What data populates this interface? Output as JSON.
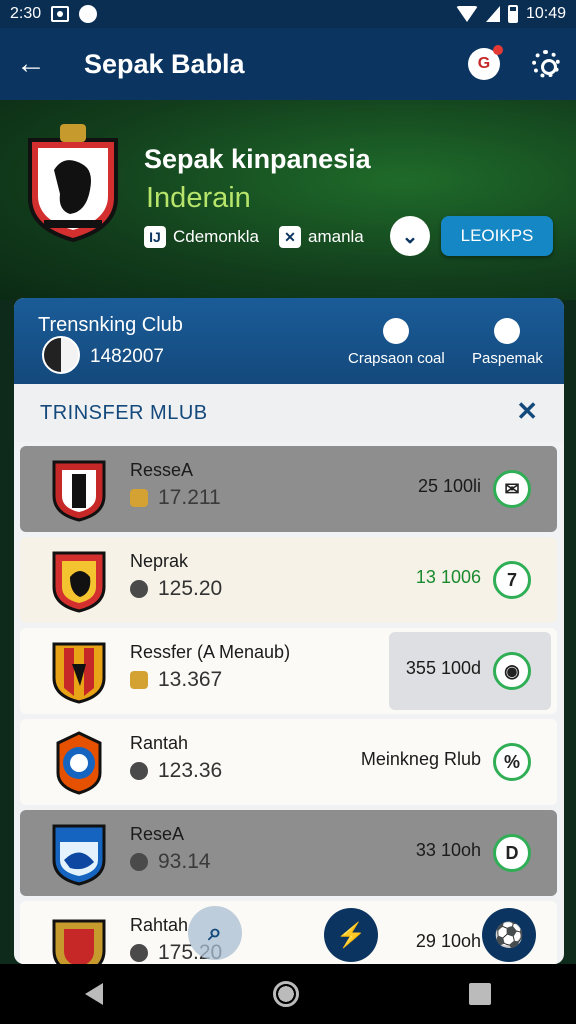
{
  "status_bar": {
    "left_text": "2:30",
    "time": "10:49"
  },
  "app_bar": {
    "title": "Sepak Babla"
  },
  "hero": {
    "title": "Sepak kinpanesia",
    "subtitle": "Inderain",
    "chip1": "Cdemonkla",
    "chip2": "amanla",
    "lookup_label": "LEOIKPS"
  },
  "panel": {
    "header_title": "Trensnking Club",
    "header_number": "1482007",
    "action1": "Crapsaon coal",
    "action2": "Paspemak",
    "list_title": "TRINSFER MLUB",
    "close": "✕"
  },
  "rows": [
    {
      "name": "ResseA",
      "value": "17.211",
      "score": "25 100li",
      "badge": ""
    },
    {
      "name": "Neprak",
      "value": "125.20",
      "score": "13 1006",
      "badge": "7"
    },
    {
      "name": "Ressfer (A Menaub)",
      "value": "13.367",
      "score": "355 100d",
      "badge": ""
    },
    {
      "name": "Rantah",
      "value": "123.36",
      "score": "Meinkneg Rlub",
      "badge": "%"
    },
    {
      "name": "ReseA",
      "value": "93.14",
      "score": "33 10oh",
      "badge": "D"
    },
    {
      "name": "Rahtah",
      "value": "175.20",
      "score": "29 10oh",
      "badge": ""
    }
  ],
  "colors": {
    "primary": "#0b3560",
    "accent": "#1587c5",
    "positive": "#2fae55",
    "hero_text": "#b7e46a"
  }
}
